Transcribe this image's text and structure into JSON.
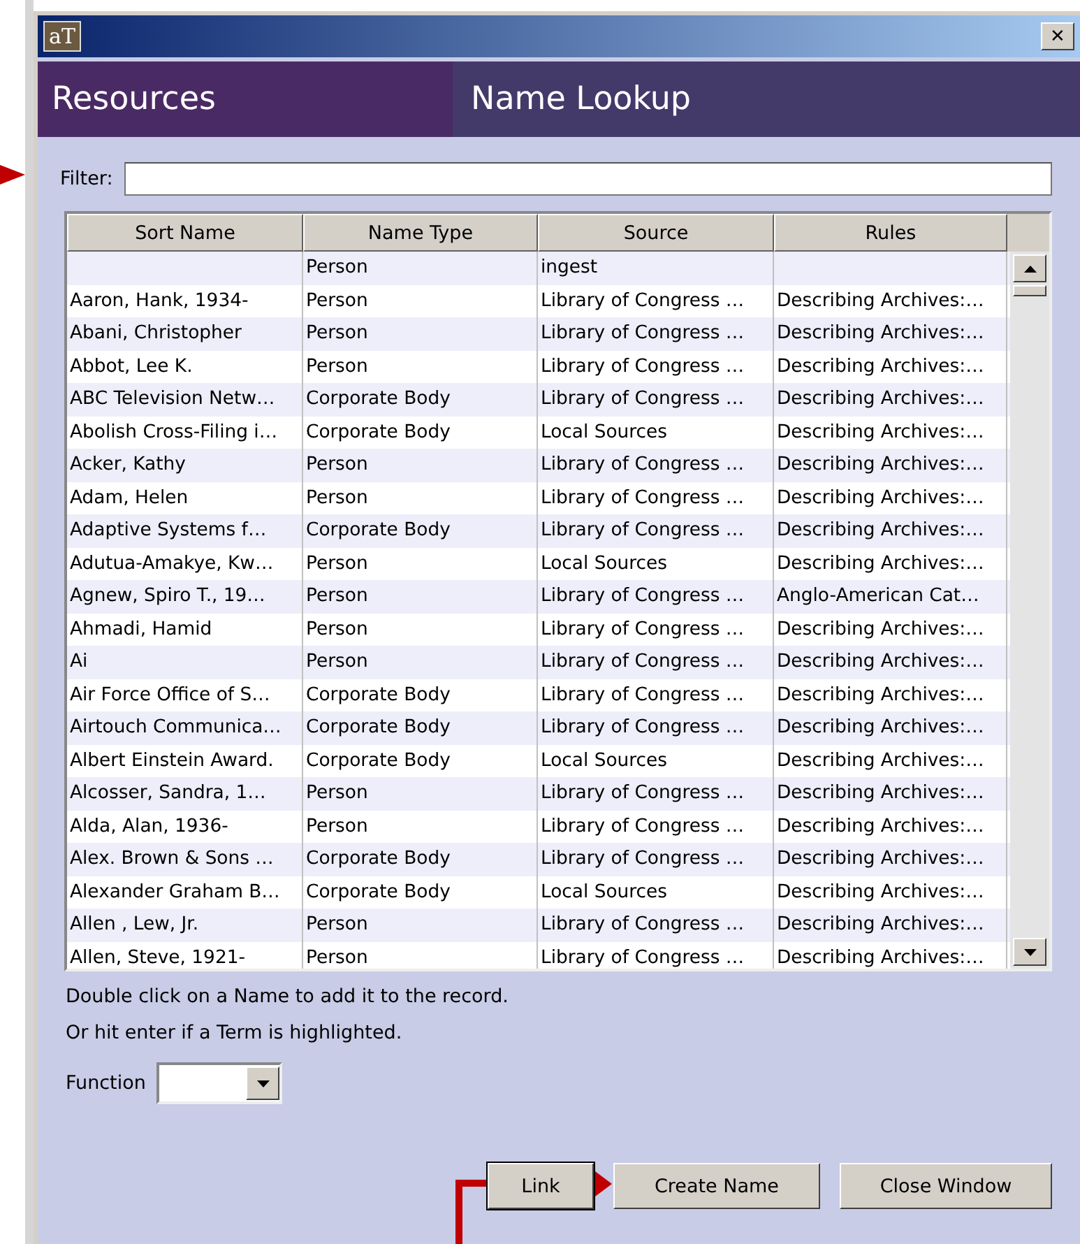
{
  "window": {
    "app_icon": "aT",
    "close": "✕"
  },
  "header": {
    "left": "Resources",
    "right": "Name Lookup"
  },
  "filter": {
    "label": "Filter:"
  },
  "table": {
    "columns": [
      "Sort Name",
      "Name Type",
      "Source",
      "Rules"
    ],
    "rows": [
      [
        "",
        "Person",
        "ingest",
        ""
      ],
      [
        "Aaron, Hank, 1934-",
        "Person",
        "Library of Congress …",
        "Describing Archives:…"
      ],
      [
        "Abani, Christopher",
        "Person",
        "Library of Congress …",
        "Describing Archives:…"
      ],
      [
        "Abbot, Lee K.",
        "Person",
        "Library of Congress …",
        "Describing Archives:…"
      ],
      [
        "ABC Television Netw…",
        "Corporate Body",
        "Library of Congress …",
        "Describing Archives:…"
      ],
      [
        "Abolish Cross-Filing i…",
        "Corporate Body",
        "Local Sources",
        "Describing Archives:…"
      ],
      [
        "Acker, Kathy",
        "Person",
        "Library of Congress …",
        "Describing Archives:…"
      ],
      [
        "Adam, Helen",
        "Person",
        "Library of Congress …",
        "Describing Archives:…"
      ],
      [
        "Adaptive Systems f…",
        "Corporate Body",
        "Library of Congress …",
        "Describing Archives:…"
      ],
      [
        "Adutua-Amakye, Kw…",
        "Person",
        "Local Sources",
        "Describing Archives:…"
      ],
      [
        "Agnew, Spiro T., 19…",
        "Person",
        "Library of Congress …",
        "Anglo-American Cat…"
      ],
      [
        "Ahmadi, Hamid",
        "Person",
        "Library of Congress …",
        "Describing Archives:…"
      ],
      [
        "Ai",
        "Person",
        "Library of Congress …",
        "Describing Archives:…"
      ],
      [
        "Air Force Office of S…",
        "Corporate Body",
        "Library of Congress …",
        "Describing Archives:…"
      ],
      [
        "Airtouch Communica…",
        "Corporate Body",
        "Library of Congress …",
        "Describing Archives:…"
      ],
      [
        "Albert Einstein Award.",
        "Corporate Body",
        "Local Sources",
        "Describing Archives:…"
      ],
      [
        "Alcosser, Sandra, 1…",
        "Person",
        "Library of Congress …",
        "Describing Archives:…"
      ],
      [
        "Alda, Alan, 1936-",
        "Person",
        "Library of Congress …",
        "Describing Archives:…"
      ],
      [
        "Alex. Brown & Sons …",
        "Corporate Body",
        "Library of Congress …",
        "Describing Archives:…"
      ],
      [
        "Alexander Graham B…",
        "Corporate Body",
        "Local Sources",
        "Describing Archives:…"
      ],
      [
        "Allen , Lew, Jr.",
        "Person",
        "Library of Congress …",
        "Describing Archives:…"
      ],
      [
        "Allen, Steve, 1921-",
        "Person",
        "Library of Congress …",
        "Describing Archives:…"
      ]
    ]
  },
  "hints": [
    "Double click on a Name to add it to the record.",
    "Or hit enter if a Term is highlighted."
  ],
  "function": {
    "label": "Function"
  },
  "buttons": [
    {
      "label": "Link",
      "default": true
    },
    {
      "label": "Create Name",
      "default": false
    },
    {
      "label": "Close Window",
      "default": false
    }
  ]
}
